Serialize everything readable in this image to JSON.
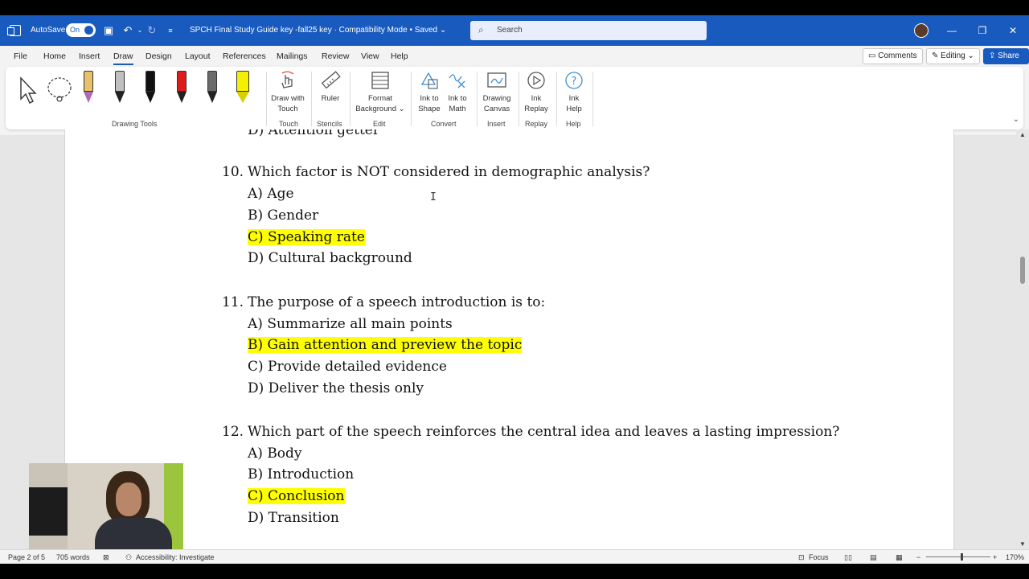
{
  "titlebar": {
    "autosave_label": "AutoSave",
    "autosave_state": "On",
    "doc_title": "SPCH Final Study Guide key -fall25 key  ·  Compatibility Mode • Saved ⌄",
    "search_placeholder": "Search"
  },
  "menu": {
    "tabs": [
      "File",
      "Home",
      "Insert",
      "Draw",
      "Design",
      "Layout",
      "References",
      "Mailings",
      "Review",
      "View",
      "Help"
    ],
    "active_tab": "Draw",
    "comments_label": "Comments",
    "editing_label": "Editing ⌄",
    "share_label": "Share ⌄"
  },
  "ribbon": {
    "groups": {
      "drawing_tools": "Drawing Tools",
      "touch": "Touch",
      "stencils": "Stencils",
      "edit": "Edit",
      "convert": "Convert",
      "insert": "Insert",
      "replay": "Replay",
      "help": "Help"
    },
    "buttons": {
      "draw_with_touch": "Draw with Touch",
      "ruler": "Ruler",
      "format_background": "Format Background ⌄",
      "ink_to_shape": "Ink to Shape",
      "ink_to_math": "Ink to Math",
      "drawing_canvas": "Drawing Canvas",
      "ink_replay": "Ink Replay",
      "ink_help": "Ink Help"
    },
    "pen_colors": [
      "#e8c26a",
      "#c0c0c0",
      "#111111",
      "#e01b1b",
      "#6b6b6b",
      "#f5f000"
    ]
  },
  "document": {
    "cutoff_line": "D) Attention getter",
    "questions": [
      {
        "number": "10.",
        "text": "Which factor is NOT considered in demographic analysis?",
        "options": [
          "A) Age",
          "B) Gender",
          "C) Speaking rate",
          "D) Cultural background"
        ],
        "highlighted_index": 2
      },
      {
        "number": "11.",
        "text": "The purpose of a speech introduction is to:",
        "options": [
          "A) Summarize all main points",
          "B) Gain attention and preview the topic",
          "C) Provide detailed evidence",
          "D) Deliver the thesis only"
        ],
        "highlighted_index": 1
      },
      {
        "number": "12.",
        "text": "Which part of the speech reinforces the central idea and leaves a lasting impression?",
        "options": [
          "A) Body",
          "B) Introduction",
          "C) Conclusion",
          "D) Transition"
        ],
        "highlighted_index": 2
      }
    ],
    "highlight_color": "#ffff00"
  },
  "statusbar": {
    "page": "Page 2 of 5",
    "words": "705 words",
    "accessibility": "Accessibility: Investigate",
    "focus": "Focus",
    "zoom": "170%"
  },
  "colors": {
    "titlebar": "#185abd",
    "ribbon_bg": "#f3f3f3",
    "doc_bg": "#e6e6e6"
  }
}
